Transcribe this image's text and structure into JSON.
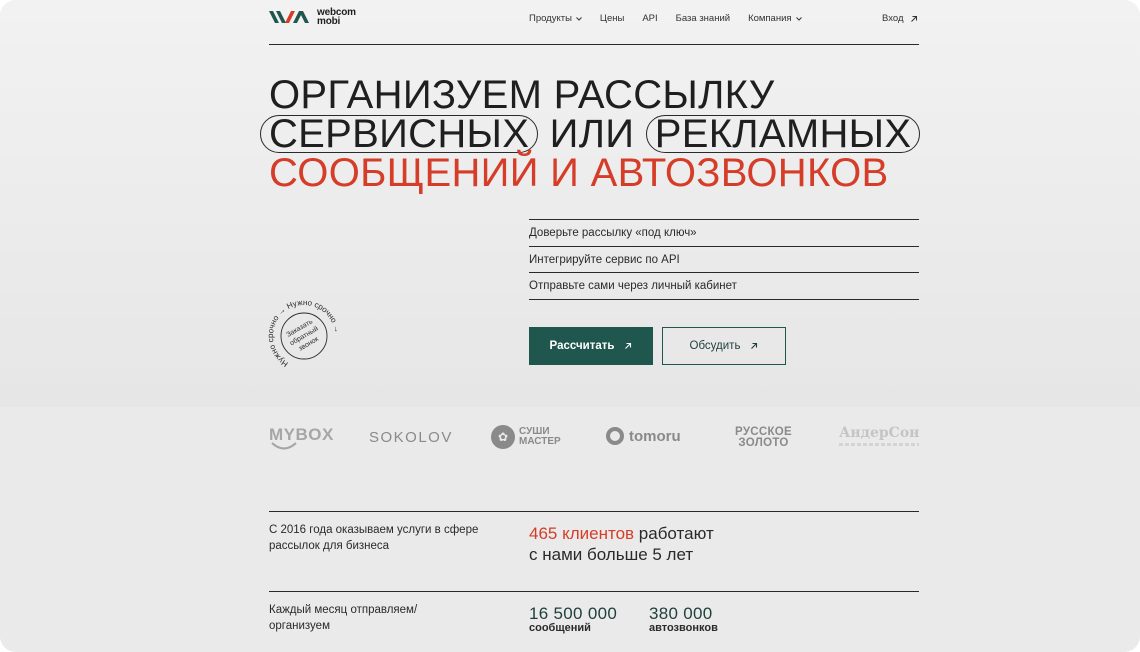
{
  "brand": {
    "logo_text_1": "webcom",
    "logo_text_2": "mobi"
  },
  "nav": {
    "items": [
      {
        "label": "Продукты",
        "has_dropdown": true
      },
      {
        "label": "Цены",
        "has_dropdown": false
      },
      {
        "label": "API",
        "has_dropdown": false
      },
      {
        "label": "База знаний",
        "has_dropdown": false
      },
      {
        "label": "Компания",
        "has_dropdown": true
      }
    ],
    "login_label": "Вход"
  },
  "hero": {
    "line1": "ОРГАНИЗУЕМ РАССЫЛКУ",
    "line2_pill1": "СЕРВИСНЫХ",
    "line2_mid": "ИЛИ",
    "line2_pill2": "РЕКЛАМНЫХ",
    "line3": "СООБЩЕНИЙ И АВТОЗВОНКОВ",
    "options": [
      "Доверьте рассылку «под ключ»",
      "Интегрируйте сервис по API",
      "Отправьте сами через личный кабинет"
    ],
    "primary_button": "Рассчитать",
    "secondary_button": "Обсудить",
    "stamp_ring_text": "Нужно срочно → Нужно срочно →",
    "stamp_center_1": "Заказать",
    "stamp_center_2": "обратный",
    "stamp_center_3": "звонок"
  },
  "clients": {
    "mybox": "MYBOX",
    "sokolov": "SOKOLOV",
    "sushi_1": "СУШИ",
    "sushi_2": "МАСТЕР",
    "tomoru": "tomoru",
    "russkoe_1": "РУССКОЕ",
    "russkoe_2": "ЗОЛОТО",
    "andersen": "АндерСон"
  },
  "stats": {
    "since_caption": "С 2016 года оказываем услуги в сфере рассылок для бизнеса",
    "clients_red": "465 клиентов",
    "clients_rest_1": " работают",
    "clients_rest_2": "с нами больше 5 лет",
    "monthly_caption": "Каждый месяц отправляем/организуем",
    "messages_value": "16 500 000",
    "messages_label": "сообщений",
    "calls_value": "380 000",
    "calls_label": "автозвонков"
  },
  "colors": {
    "accent_green": "#1f574f",
    "accent_red": "#d63d29",
    "text": "#1f1f1f"
  },
  "icons": [
    "logo-mark",
    "chevron-down-icon",
    "arrow-up-right-icon",
    "stamp-badge"
  ]
}
